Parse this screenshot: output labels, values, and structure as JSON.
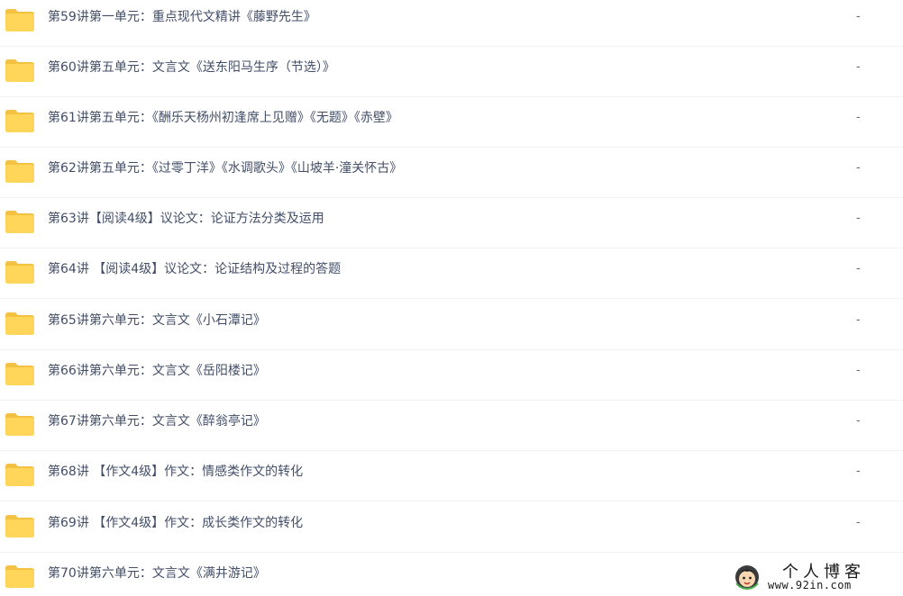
{
  "colors": {
    "folder_body": "#ffd659",
    "folder_tab": "#f5c142",
    "file_name_text": "#424e67",
    "row_divider": "#f1f2f4"
  },
  "files": [
    {
      "icon": "folder-icon",
      "name": "第59讲第一单元：重点现代文精讲《藤野先生》",
      "size": "-"
    },
    {
      "icon": "folder-icon",
      "name": "第60讲第五单元：文言文《送东阳马生序（节选）》",
      "size": "-"
    },
    {
      "icon": "folder-icon",
      "name": "第61讲第五单元：《酬乐天杨州初逢席上见赠》《无题》《赤壁》",
      "size": "-"
    },
    {
      "icon": "folder-icon",
      "name": "第62讲第五单元：《过零丁洋》《水调歌头》《山坡羊·潼关怀古》",
      "size": "-"
    },
    {
      "icon": "folder-icon",
      "name": "第63讲【阅读4级】议论文：论证方法分类及运用",
      "size": "-"
    },
    {
      "icon": "folder-icon",
      "name": "第64讲 【阅读4级】议论文：论证结构及过程的答题",
      "size": "-"
    },
    {
      "icon": "folder-icon",
      "name": "第65讲第六单元：文言文《小石潭记》",
      "size": "-"
    },
    {
      "icon": "folder-icon",
      "name": "第66讲第六单元：文言文《岳阳楼记》",
      "size": "-"
    },
    {
      "icon": "folder-icon",
      "name": "第67讲第六单元：文言文《醉翁亭记》",
      "size": "-"
    },
    {
      "icon": "folder-icon",
      "name": "第68讲 【作文4级】作文：情感类作文的转化",
      "size": "-"
    },
    {
      "icon": "folder-icon",
      "name": "第69讲 【作文4级】作文：成长类作文的转化",
      "size": "-"
    },
    {
      "icon": "folder-icon",
      "name": "第70讲第六单元：文言文《满井游记》",
      "size": "-"
    }
  ],
  "watermark": {
    "icon": "avatar-icon",
    "title": "个人博客",
    "url": "www.92in.com"
  }
}
